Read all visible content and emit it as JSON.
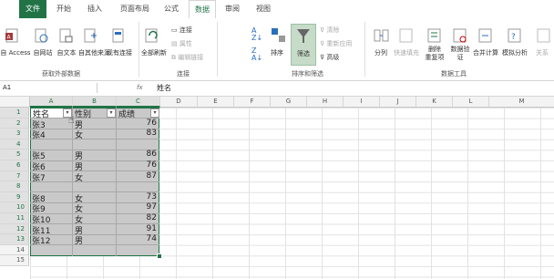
{
  "tabs": [
    "文件",
    "开始",
    "插入",
    "页面布局",
    "公式",
    "数据",
    "审阅",
    "视图"
  ],
  "ribbon": {
    "external": [
      "自 Access",
      "自网站",
      "自文本",
      "自其他来源",
      "现有连接"
    ],
    "refresh": "全部刷新",
    "conn_small": [
      "连接",
      "属性",
      "编辑链接"
    ],
    "sort": "排序",
    "filter": "筛选",
    "filter_small": [
      "清除",
      "重新应用",
      "高级"
    ],
    "split": "分列",
    "flashfill": "快速填充",
    "dup": [
      "删除",
      "重复项"
    ],
    "valid": [
      "数据验",
      "证"
    ],
    "consolidate": "合并计算",
    "whatif": "模拟分析",
    "relation": "关系",
    "groups": [
      "获取外部数据",
      "连接",
      "排序和筛选",
      "数据工具"
    ]
  },
  "formula": {
    "name_box": "A1",
    "fx": "fx",
    "content": "姓名"
  },
  "columns": [
    "A",
    "B",
    "C",
    "D",
    "E",
    "F",
    "G",
    "H",
    "I",
    "J",
    "K",
    "L",
    "M"
  ],
  "rows": [
    "1",
    "2",
    "3",
    "4",
    "5",
    "6",
    "7",
    "8",
    "9",
    "10",
    "11",
    "12",
    "13",
    "14",
    "15"
  ],
  "headers": {
    "name": "姓名",
    "gender": "性别",
    "score": "成绩"
  },
  "data": [
    {
      "r": "2",
      "name": "张3",
      "gender": "男",
      "score": "76"
    },
    {
      "r": "3",
      "name": "张4",
      "gender": "女",
      "score": "83"
    },
    {
      "r": "4",
      "name": "",
      "gender": "",
      "score": ""
    },
    {
      "r": "5",
      "name": "张5",
      "gender": "男",
      "score": "86"
    },
    {
      "r": "6",
      "name": "张6",
      "gender": "男",
      "score": "76"
    },
    {
      "r": "7",
      "name": "张7",
      "gender": "女",
      "score": "87"
    },
    {
      "r": "8",
      "name": "",
      "gender": "",
      "score": ""
    },
    {
      "r": "9",
      "name": "张8",
      "gender": "女",
      "score": "73"
    },
    {
      "r": "10",
      "name": "张9",
      "gender": "女",
      "score": "97"
    },
    {
      "r": "11",
      "name": "张10",
      "gender": "女",
      "score": "82"
    },
    {
      "r": "12",
      "name": "张11",
      "gender": "男",
      "score": "91"
    },
    {
      "r": "13",
      "name": "张12",
      "gender": "男",
      "score": "74"
    }
  ],
  "colors": {
    "accent": "#217346",
    "selection": "#c9c9c9",
    "filter_active": "#c6dcc8"
  }
}
